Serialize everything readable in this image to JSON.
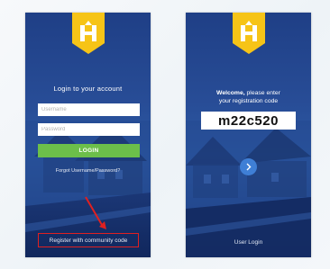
{
  "left_screen": {
    "login_title": "Login to your account",
    "username_placeholder": "Username",
    "password_placeholder": "Password",
    "login_button": "LOGIN",
    "forgot_link": "Forgot Username/Password?",
    "register_link": "Register with community code"
  },
  "right_screen": {
    "welcome_bold": "Welcome,",
    "welcome_line1_rest": " please enter",
    "welcome_line2": "your registration code",
    "registration_code": "m22c520",
    "user_login_link": "User Login"
  },
  "colors": {
    "logo_yellow": "#f6c417",
    "login_green": "#6cbf4a",
    "highlight_red": "#e02020",
    "next_button_blue": "#3f7fd6"
  },
  "icons": {
    "logo": "house-logo-icon",
    "next": "chevron-right-icon",
    "annotation": "red-arrow-icon"
  }
}
